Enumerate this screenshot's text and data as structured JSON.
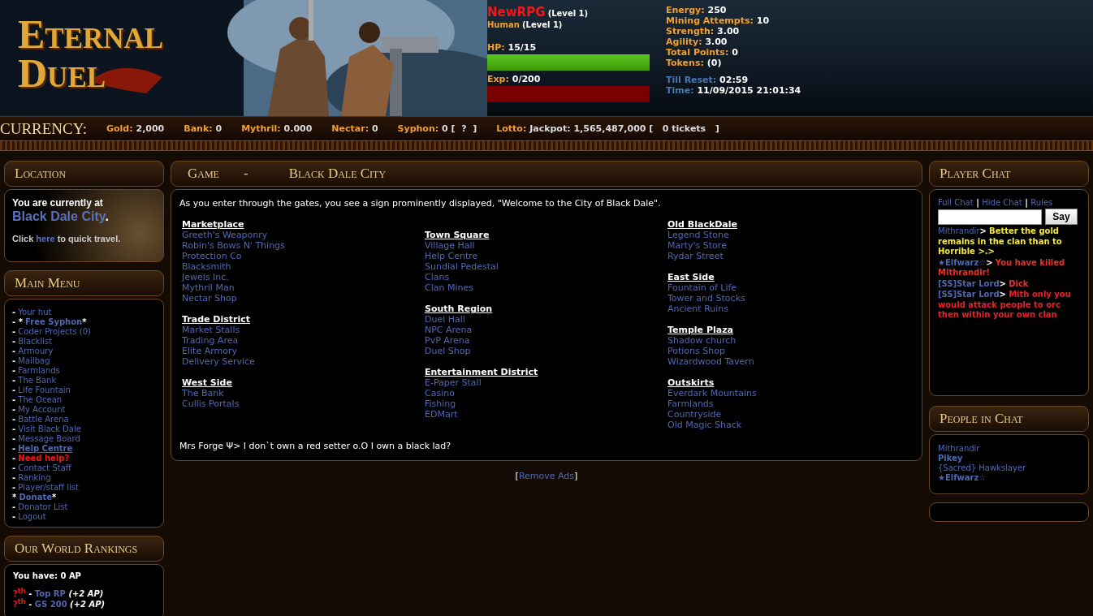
{
  "header": {
    "logo": "Eternal Duel",
    "player": {
      "name": "NewRPG",
      "name_level": "(Level 1)",
      "race": "Human",
      "race_level": "(Level 1)"
    },
    "bars": [
      {
        "kind": "hp",
        "label": "HP:",
        "value": "15/15",
        "level": 1
      },
      {
        "kind": "exp",
        "label": "Exp:",
        "value": "0/200",
        "level": 0
      }
    ],
    "stats": [
      {
        "kind": "stat",
        "label": "Energy:",
        "value": "250"
      },
      {
        "kind": "stat",
        "label": "Mining Attempts:",
        "value": "10"
      },
      {
        "kind": "stat",
        "label": "Strength:",
        "value": "3.00"
      },
      {
        "kind": "stat",
        "label": "Agility:",
        "value": "3.00"
      },
      {
        "kind": "stat",
        "label": "Total Points:",
        "value": "0"
      },
      {
        "kind": "stat",
        "label": "Tokens:",
        "value": "(0)"
      },
      {
        "kind": "time",
        "label": "Till Reset:",
        "value": "02:59"
      },
      {
        "kind": "time",
        "label": "Time:",
        "value": "11/09/2015 21:01:34"
      }
    ]
  },
  "currency": {
    "title": "CURRENCY:",
    "items": [
      {
        "label": "Gold:",
        "value": "2,000"
      },
      {
        "label": "Bank:",
        "value": "0"
      },
      {
        "label": "Mythril:",
        "value": "0.000"
      },
      {
        "label": "Nectar:",
        "value": "0"
      },
      {
        "label": "Syphon:",
        "value": "0 [  ?  ]"
      },
      {
        "label": "Lotto:",
        "value": "Jackpot: 1,565,487,000 [   0 tickets   ]"
      }
    ]
  },
  "location": {
    "title": "Location",
    "intro": "You are currently at",
    "place": "Black Dale City",
    "period": ".",
    "click": "Click",
    "link": "here",
    "rest": "to quick travel."
  },
  "main_menu": {
    "title": "Main Menu",
    "items": [
      {
        "prefix": "-",
        "label": "Your hut",
        "kind": "link"
      },
      {
        "prefix": "- *",
        "label": "Free Syphon",
        "suffix": "*",
        "kind": "bold"
      },
      {
        "prefix": "-",
        "label": "Coder Projects (0)",
        "kind": "link"
      },
      {
        "prefix": "-",
        "label": "Blacklist",
        "kind": "link"
      },
      {
        "prefix": "-",
        "label": "Armoury",
        "kind": "link"
      },
      {
        "prefix": "-",
        "label": "Mailbag",
        "kind": "link"
      },
      {
        "prefix": "-",
        "label": "Farmlands",
        "kind": "link"
      },
      {
        "prefix": "-",
        "label": "The Bank",
        "kind": "link"
      },
      {
        "prefix": "-",
        "label": "Life Fountain",
        "kind": "link"
      },
      {
        "prefix": "-",
        "label": "The Ocean",
        "kind": "link"
      },
      {
        "prefix": "-",
        "label": "My Account",
        "kind": "link"
      },
      {
        "prefix": "-",
        "label": "Battle Arena",
        "kind": "link"
      },
      {
        "prefix": "-",
        "label": "Visit Black Dale",
        "kind": "link"
      },
      {
        "prefix": "-",
        "label": "Message Board",
        "kind": "link"
      },
      {
        "prefix": "-",
        "label": "Help Centre",
        "kind": "underlined"
      },
      {
        "prefix": "-",
        "label": "Need help?",
        "kind": "alert"
      },
      {
        "prefix": "-",
        "label": "Contact Staff",
        "kind": "link"
      },
      {
        "prefix": "-",
        "label": "Ranking",
        "kind": "link"
      },
      {
        "prefix": "-",
        "label": "Player/staff list",
        "kind": "link"
      },
      {
        "prefix": "*",
        "label": "Donate",
        "suffix": "*",
        "kind": "bold"
      },
      {
        "prefix": "-",
        "label": "Donator List",
        "kind": "link"
      },
      {
        "prefix": "-",
        "label": "Logout",
        "kind": "link"
      }
    ]
  },
  "rankings": {
    "title": "Our World Rankings",
    "summary": "You have: 0 AP",
    "entries": [
      {
        "rank": "?$^{th}$",
        "dash": "-",
        "name": "Top RP",
        "bonus": "(+2 AP)"
      },
      {
        "rank": "?$^{th}$",
        "dash": "-",
        "name": "GS 200",
        "bonus": "(+2 AP)"
      }
    ]
  },
  "game": {
    "title": "Game",
    "separator": "-",
    "place": "Black Dale City",
    "intro": "As you enter through the gates, you see a sign prominently displayed, \"Welcome to the City of Black Dale\".",
    "columns": [
      [
        {
          "title": "Marketplace",
          "links": [
            "Greeth's Weaponry",
            "Robin's Bows N' Things",
            "Protection Co",
            "Blacksmith",
            "Jewels Inc.",
            "Mythril Man",
            "Nectar Shop"
          ]
        },
        {
          "title": "Trade District",
          "links": [
            "Market Stalls",
            "Trading Area",
            "Elite Armory",
            "Delivery Service"
          ]
        },
        {
          "title": "West Side",
          "links": [
            "The Bank",
            "Cullis Portals"
          ]
        }
      ],
      [
        {
          "title": "Town Square",
          "links": [
            "Village Hall",
            "Help Centre",
            "Sundial Pedestal",
            "Clans",
            "Clan Mines"
          ]
        },
        {
          "title": "South Region",
          "links": [
            "Duel Hall",
            "NPC Arena",
            "PvP Arena",
            "Duel Shop"
          ]
        },
        {
          "title": "Entertainment District",
          "links": [
            "E-Paper Stall",
            "Casino",
            "Fishing",
            "EDMart"
          ]
        }
      ],
      [
        {
          "title": "Old BlackDale",
          "links": [
            "Legend Stone",
            "Marty's Store",
            "Rydar Street"
          ]
        },
        {
          "title": "East Side",
          "links": [
            "Fountain of Life",
            "Tower and Stocks",
            "Ancient Ruins"
          ]
        },
        {
          "title": "Temple Plaza",
          "links": [
            "Shadow church",
            "Potions Shop",
            "Wizardwood Tavern"
          ]
        },
        {
          "title": "Outskirts",
          "links": [
            "Everdark Mountains",
            "Farmlands",
            "Countryside",
            "Old Magic Shack"
          ]
        }
      ]
    ],
    "last_chat": "Mrs Forge Ψ> I don`t own a red setter o.O I own a black lad?",
    "remove_ads": {
      "open": "[",
      "link": "Remove Ads",
      "close": "]"
    }
  },
  "player_chat": {
    "title": "Player Chat",
    "links": [
      "Full Chat",
      "Hide Chat",
      "Rules"
    ],
    "separator": "|",
    "button": "Say",
    "messages": [
      {
        "user": "Mithrandir",
        "user_bold": false,
        "prompt": ">",
        "text": "Better the gold remains in the clan than to Horrible >.>",
        "color": "#f4e83a"
      },
      {
        "user": "★Elfwarz☆",
        "user_bold": true,
        "prompt": ">",
        "text": "You have killed Mithrandir!",
        "color": "#e8302a"
      },
      {
        "user": "[SS]Star Lord",
        "user_bold": true,
        "prompt": ">",
        "text": "Dick",
        "color": "#e8302a"
      },
      {
        "user": "[SS]Star Lord",
        "user_bold": true,
        "prompt": ">",
        "text": "Mith only you would attack people to orc then within your own clan",
        "color": "#e8202a"
      }
    ]
  },
  "people_in_chat": {
    "title": "People in Chat",
    "people": [
      {
        "name": "Mithrandir",
        "kind": "plain"
      },
      {
        "name": "Pikey",
        "kind": "bold"
      },
      {
        "name": "{Sacred} Hawkslayer",
        "kind": "plain"
      },
      {
        "name": "★Elfwarz☆",
        "kind": "bold"
      }
    ]
  }
}
